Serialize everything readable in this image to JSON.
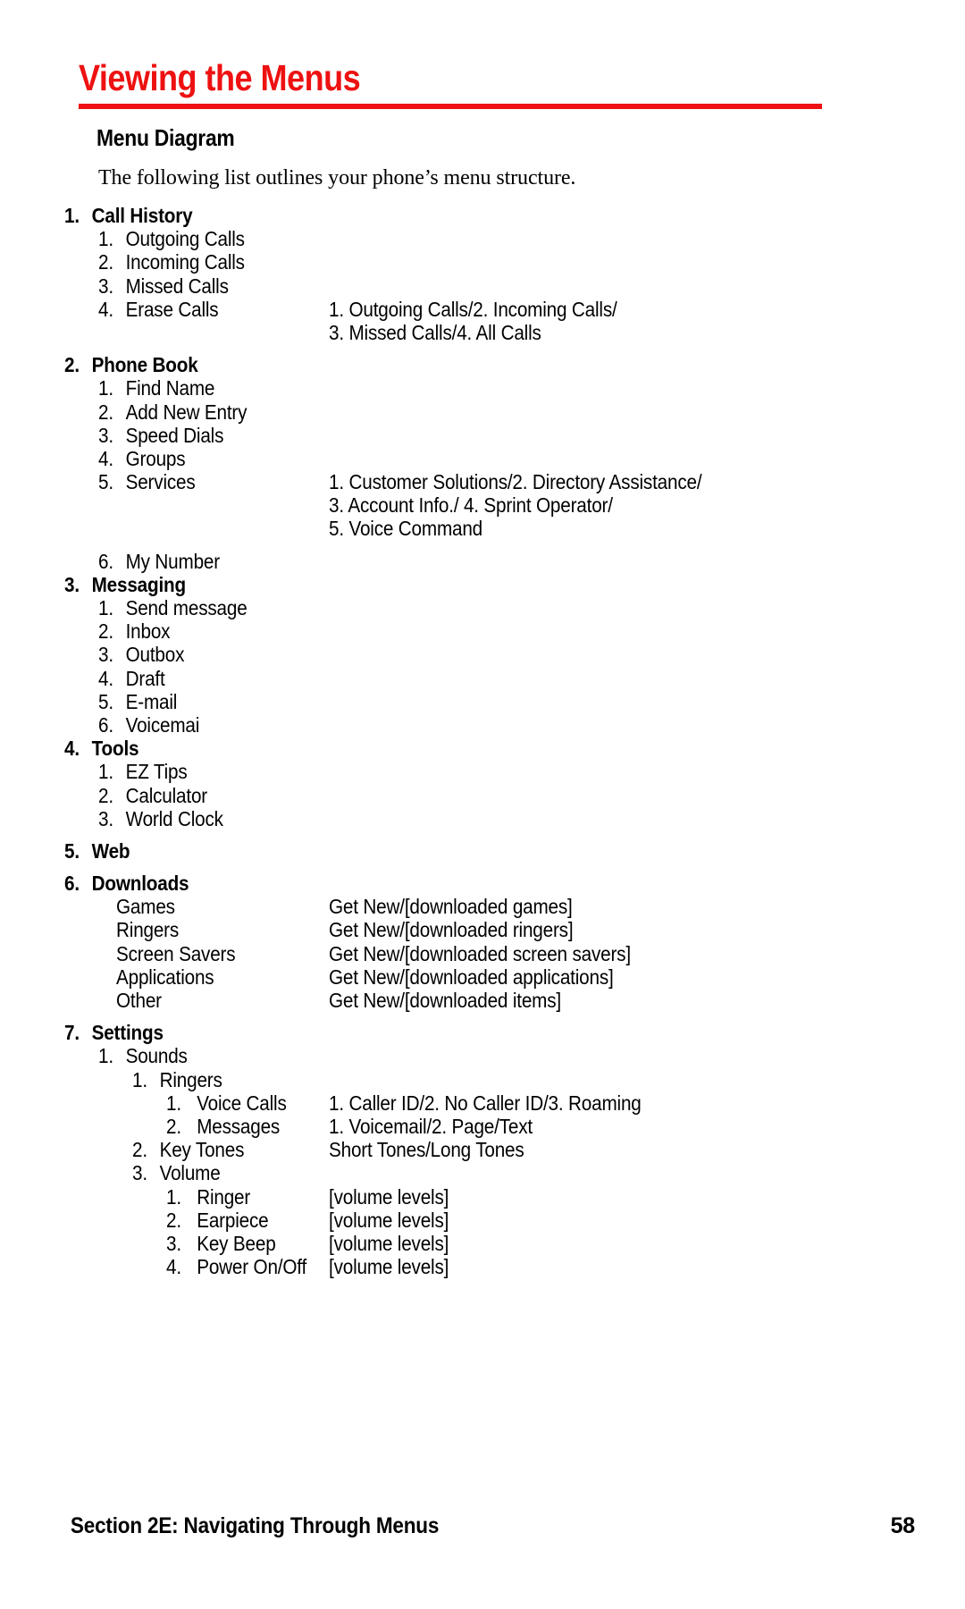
{
  "header": {
    "title": "Viewing the Menus",
    "title_color": "#ee1111",
    "sub_heading": "Menu Diagram",
    "intro": "The following list outlines your phone’s menu structure."
  },
  "footer": {
    "section_label": "Section 2E: Navigating Through Menus",
    "page_number": "58"
  },
  "outline": [
    {
      "level": 1,
      "num": "1.",
      "label": "Call History",
      "right": "",
      "gap_before": false
    },
    {
      "level": 2,
      "num": "1.",
      "label": "Outgoing Calls",
      "right": ""
    },
    {
      "level": 2,
      "num": "2.",
      "label": "Incoming Calls",
      "right": ""
    },
    {
      "level": 2,
      "num": "3.",
      "label": "Missed Calls",
      "right": ""
    },
    {
      "level": 2,
      "num": "4.",
      "label": "Erase Calls",
      "right": "1. Outgoing Calls/2. Incoming Calls/"
    },
    {
      "level": 2,
      "num": "",
      "label": "",
      "right": "3. Missed Calls/4. All Calls"
    },
    {
      "level": 1,
      "num": "2.",
      "label": "Phone Book",
      "right": "",
      "gap_before": true
    },
    {
      "level": 2,
      "num": "1.",
      "label": "Find Name",
      "right": ""
    },
    {
      "level": 2,
      "num": "2.",
      "label": "Add New Entry",
      "right": ""
    },
    {
      "level": 2,
      "num": "3.",
      "label": "Speed Dials",
      "right": ""
    },
    {
      "level": 2,
      "num": "4.",
      "label": "Groups",
      "right": ""
    },
    {
      "level": 2,
      "num": "5.",
      "label": "Services",
      "right": "1. Customer Solutions/2. Directory Assistance/"
    },
    {
      "level": 2,
      "num": "",
      "label": "",
      "right": "3. Account Info./ 4. Sprint Operator/"
    },
    {
      "level": 2,
      "num": "",
      "label": "",
      "right": "5. Voice Command"
    },
    {
      "level": 2,
      "num": "6.",
      "label": "My Number",
      "right": "",
      "gap_before": true
    },
    {
      "level": 1,
      "num": "3.",
      "label": "Messaging",
      "right": ""
    },
    {
      "level": 2,
      "num": "1.",
      "label": "Send message",
      "right": ""
    },
    {
      "level": 2,
      "num": "2.",
      "label": "Inbox",
      "right": ""
    },
    {
      "level": 2,
      "num": "3.",
      "label": "Outbox",
      "right": ""
    },
    {
      "level": 2,
      "num": "4.",
      "label": "Draft",
      "right": ""
    },
    {
      "level": 2,
      "num": "5.",
      "label": "E-mail",
      "right": ""
    },
    {
      "level": 2,
      "num": "6.",
      "label": "Voicemai",
      "right": ""
    },
    {
      "level": 1,
      "num": "4.",
      "label": "Tools",
      "right": ""
    },
    {
      "level": 2,
      "num": "1.",
      "label": "EZ Tips",
      "right": ""
    },
    {
      "level": 2,
      "num": "2.",
      "label": "Calculator",
      "right": ""
    },
    {
      "level": 2,
      "num": "3.",
      "label": "World Clock",
      "right": ""
    },
    {
      "level": 1,
      "num": "5.",
      "label": "Web",
      "right": "",
      "gap_before": true
    },
    {
      "level": 1,
      "num": "6.",
      "label": "Downloads",
      "right": "",
      "gap_before": true
    },
    {
      "level": "2n",
      "num": "",
      "label": "Games",
      "right": "Get New/[downloaded games]"
    },
    {
      "level": "2n",
      "num": "",
      "label": "Ringers",
      "right": "Get New/[downloaded ringers]"
    },
    {
      "level": "2n",
      "num": "",
      "label": "Screen Savers",
      "right": "Get New/[downloaded screen savers]"
    },
    {
      "level": "2n",
      "num": "",
      "label": "Applications",
      "right": "Get New/[downloaded applications]"
    },
    {
      "level": "2n",
      "num": "",
      "label": "Other",
      "right": "Get New/[downloaded items]"
    },
    {
      "level": 1,
      "num": "7.",
      "label": "Settings",
      "right": "",
      "gap_before": true
    },
    {
      "level": 2,
      "num": "1.",
      "label": "Sounds",
      "right": ""
    },
    {
      "level": 3,
      "num": "1.",
      "label": "Ringers",
      "right": ""
    },
    {
      "level": 4,
      "num": "1.",
      "label": "Voice Calls",
      "right": "1. Caller ID/2. No Caller ID/3. Roaming"
    },
    {
      "level": 4,
      "num": "2.",
      "label": "Messages",
      "right": "1. Voicemail/2. Page/Text"
    },
    {
      "level": 3,
      "num": "2.",
      "label": "Key Tones",
      "right": "Short Tones/Long Tones"
    },
    {
      "level": 3,
      "num": "3.",
      "label": "Volume",
      "right": ""
    },
    {
      "level": 4,
      "num": "1.",
      "label": "Ringer",
      "right": "[volume levels]"
    },
    {
      "level": 4,
      "num": "2.",
      "label": "Earpiece",
      "right": "[volume levels]"
    },
    {
      "level": 4,
      "num": "3.",
      "label": "Key Beep",
      "right": "[volume levels]"
    },
    {
      "level": 4,
      "num": "4.",
      "label": "Power On/Off",
      "right": "[volume levels]"
    }
  ]
}
